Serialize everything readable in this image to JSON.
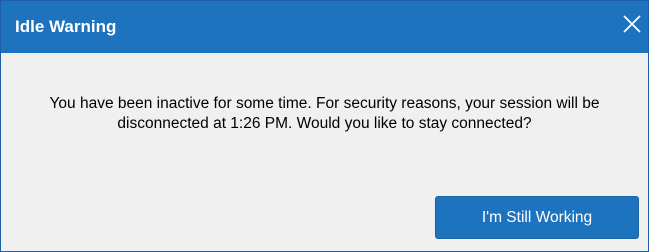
{
  "window": {
    "title": "Idle Warning",
    "close_icon": "close-icon"
  },
  "message": {
    "text": "You have been inactive for some time.  For security reasons, your session will be disconnected at 1:26 PM.  Would you like to stay connected?"
  },
  "actions": {
    "primary_label": "I'm Still Working"
  },
  "colors": {
    "title_bar": "#1e73be",
    "button": "#1e73be",
    "body_background": "#f0f0f0",
    "border": "#1c5fa6"
  }
}
